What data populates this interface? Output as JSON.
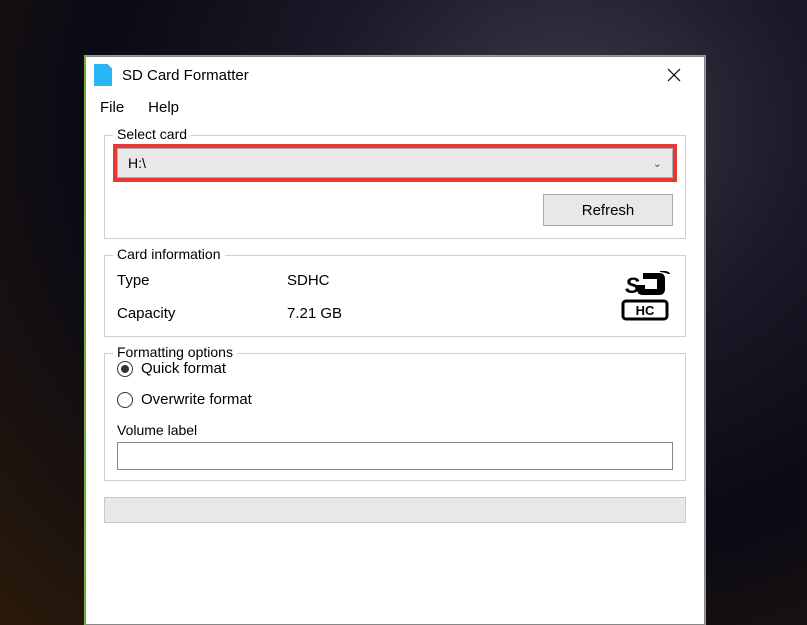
{
  "window": {
    "title": "SD Card Formatter"
  },
  "menu": {
    "file": "File",
    "help": "Help"
  },
  "selectCard": {
    "legend": "Select card",
    "value": "H:\\",
    "refresh": "Refresh"
  },
  "cardInfo": {
    "legend": "Card information",
    "typeLabel": "Type",
    "typeValue": "SDHC",
    "capacityLabel": "Capacity",
    "capacityValue": "7.21 GB"
  },
  "formatOpts": {
    "legend": "Formatting options",
    "quick": "Quick format",
    "overwrite": "Overwrite format",
    "volumeLabel": "Volume label",
    "volumeValue": ""
  }
}
